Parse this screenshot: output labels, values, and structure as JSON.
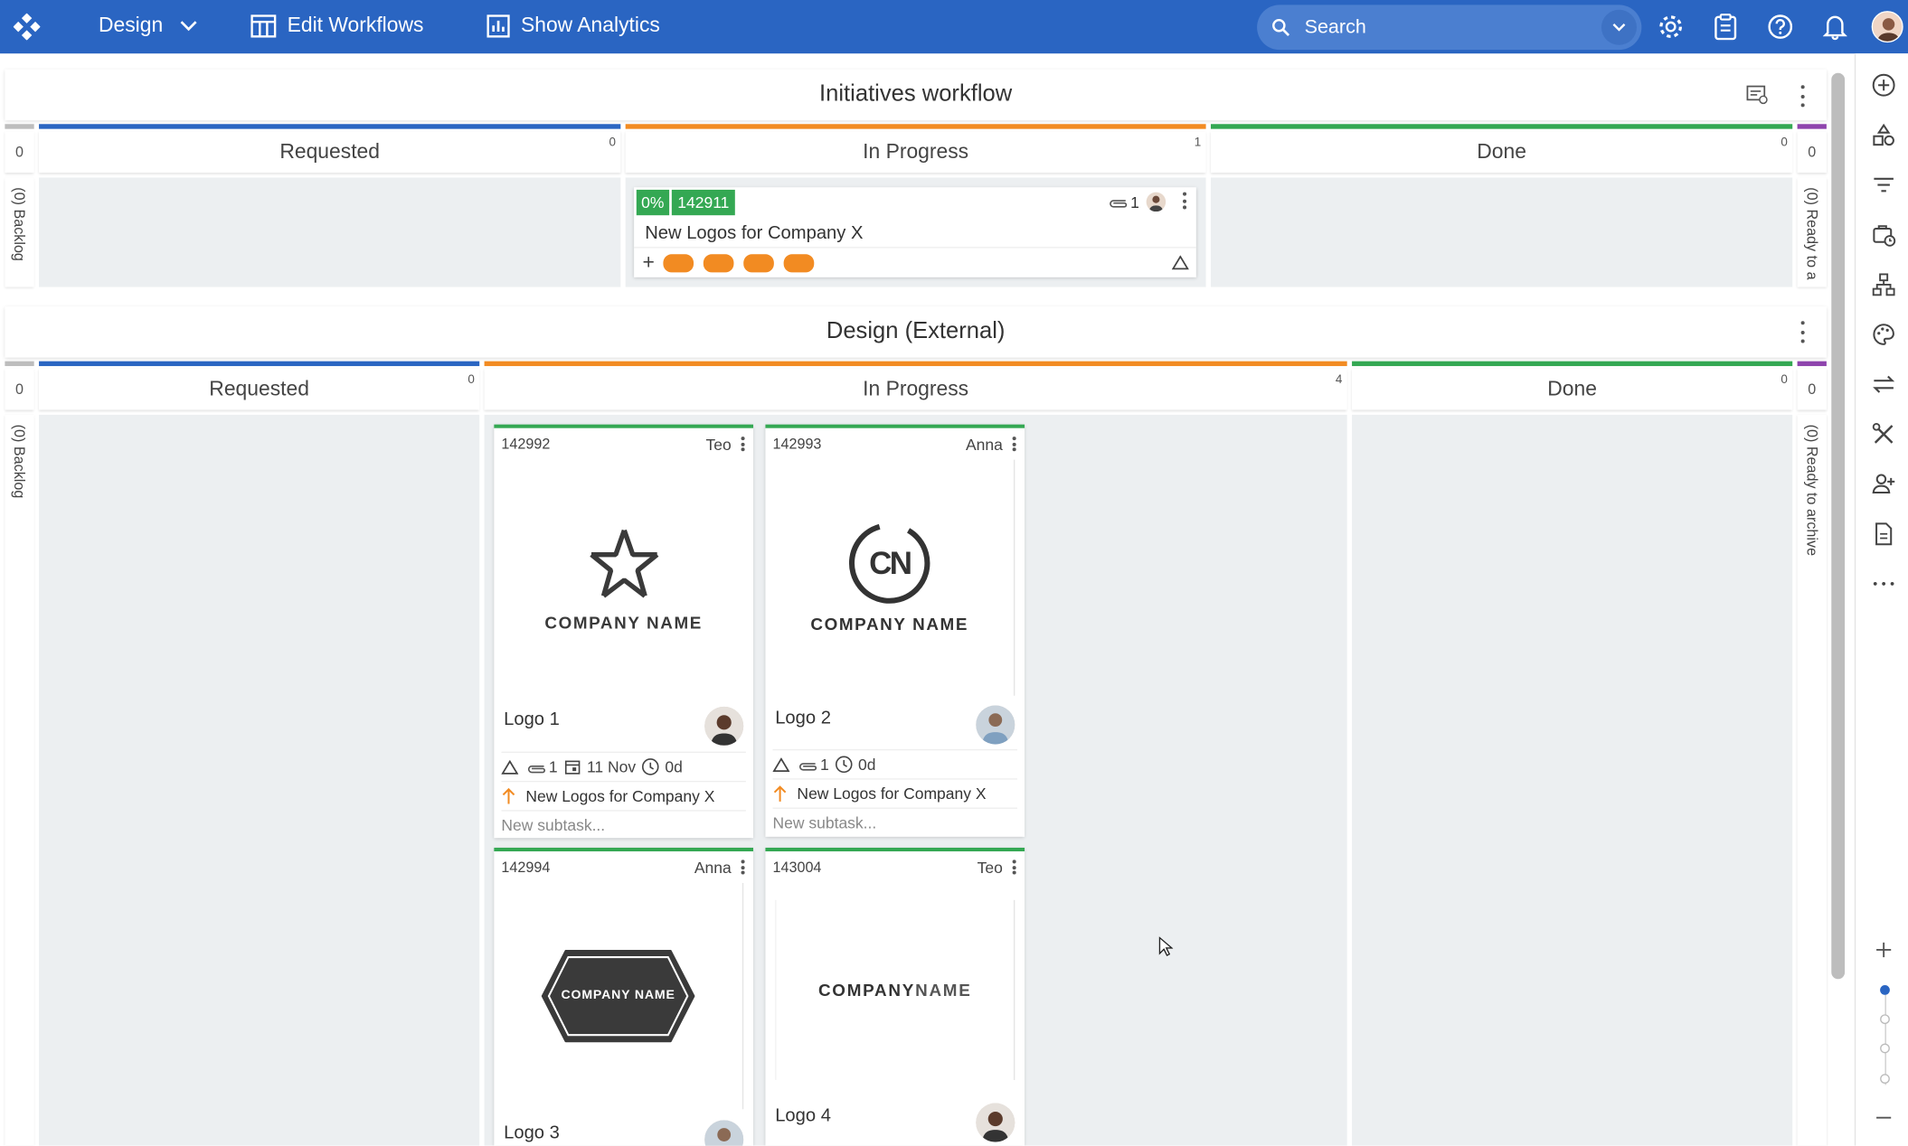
{
  "topbar": {
    "project": "Design",
    "edit_workflows": "Edit Workflows",
    "show_analytics": "Show Analytics",
    "search_placeholder": "Search"
  },
  "workflows": [
    {
      "title": "Initiatives workflow",
      "left_side": {
        "count": "0",
        "label": "(0) Backlog"
      },
      "right_side": {
        "count": "0",
        "label": "(0) Ready to a"
      },
      "columns": [
        {
          "name": "Requested",
          "count": "0",
          "color": "#2a65c2"
        },
        {
          "name": "In Progress",
          "count": "1",
          "color": "#f28b22"
        },
        {
          "name": "Done",
          "count": "0",
          "color": "#34a853"
        }
      ],
      "card": {
        "progress": "0%",
        "id": "142911",
        "attachments": "1",
        "title": "New Logos for Company X"
      }
    },
    {
      "title": "Design (External)",
      "left_side": {
        "count": "0",
        "label": "(0) Backlog"
      },
      "right_side": {
        "count": "0",
        "label": "(0) Ready to archive"
      },
      "columns": [
        {
          "name": "Requested",
          "count": "0",
          "color": "#2a65c2"
        },
        {
          "name": "In Progress",
          "count": "4",
          "color": "#f28b22"
        },
        {
          "name": "Done",
          "count": "0",
          "color": "#34a853"
        }
      ],
      "cards": [
        {
          "id": "142992",
          "assignee": "Teo",
          "logo_text": "COMPANY NAME",
          "title": "Logo 1",
          "attachments": "1",
          "date": "11 Nov",
          "time": "0d",
          "parent": "New Logos for Company X",
          "subtask_placeholder": "New subtask..."
        },
        {
          "id": "142993",
          "assignee": "Anna",
          "logo_text": "COMPANY NAME",
          "logo_mark": "CN",
          "title": "Logo 2",
          "attachments": "1",
          "time": "0d",
          "parent": "New Logos for Company X",
          "subtask_placeholder": "New subtask..."
        },
        {
          "id": "142994",
          "assignee": "Anna",
          "logo_text": "COMPANY NAME",
          "title": "Logo 3"
        },
        {
          "id": "143004",
          "assignee": "Teo",
          "logo_text_a": "COMPANY",
          "logo_text_b": "NAME",
          "title": "Logo 4"
        }
      ]
    }
  ]
}
